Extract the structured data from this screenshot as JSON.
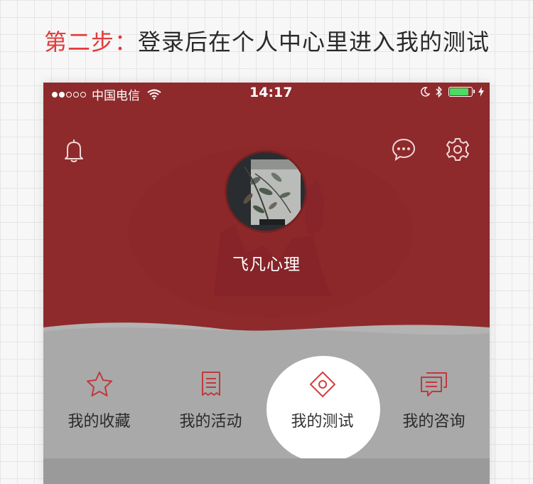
{
  "instruction": {
    "step": "第二步：",
    "text": "登录后在个人中心里进入我的测试"
  },
  "status_bar": {
    "carrier": "中国电信",
    "time": "14:17",
    "signal_bars": 2,
    "battery_level": 0.85
  },
  "header": {
    "left_icon": "bell-icon",
    "right_icons": [
      "chat-bubble-icon",
      "gear-icon"
    ]
  },
  "profile": {
    "username": "飞凡心理"
  },
  "menu": {
    "items": [
      {
        "label": "我的收藏",
        "icon": "star-icon"
      },
      {
        "label": "我的活动",
        "icon": "document-icon"
      },
      {
        "label": "我的测试",
        "icon": "diamond-target-icon",
        "highlighted": true
      },
      {
        "label": "我的咨询",
        "icon": "double-chat-icon"
      }
    ]
  },
  "colors": {
    "step": "#e23b3b",
    "header": "#8e2a2c",
    "accent": "#c0393c",
    "overlay": "#a9a9a9"
  }
}
